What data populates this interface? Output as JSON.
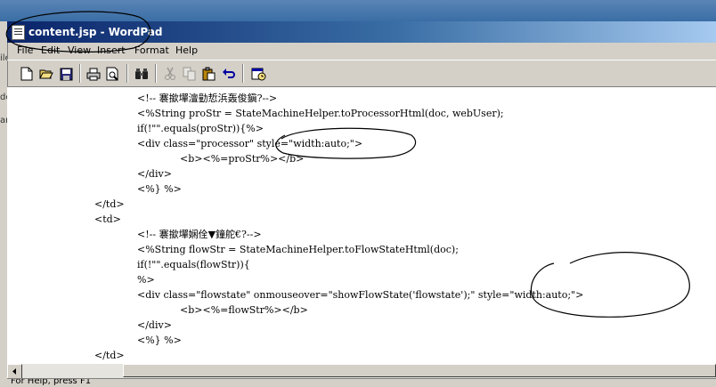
{
  "window": {
    "title": "content.jsp - WordPad"
  },
  "left_pane": {
    "fragments": [
      "ile",
      "dc",
      "ar"
    ]
  },
  "menu": [
    "File",
    "Edit",
    "View",
    "Insert",
    "Format",
    "Help"
  ],
  "toolbar": {
    "buttons": [
      {
        "name": "new-icon"
      },
      {
        "name": "open-icon"
      },
      {
        "name": "save-icon"
      },
      {
        "name": "print-icon"
      },
      {
        "name": "print-preview-icon"
      },
      {
        "name": "find-icon"
      },
      {
        "name": "cut-icon"
      },
      {
        "name": "copy-icon"
      },
      {
        "name": "paste-icon"
      },
      {
        "name": "undo-icon"
      },
      {
        "name": "insert-date-time-icon"
      }
    ]
  },
  "document": {
    "lines": [
      "<!-- 褰撳墠澶勭悊浜轰俊鎭?-->",
      "<%String proStr = StateMachineHelper.toProcessorHtml(doc, webUser);",
      "if(!\"\".equals(proStr)){%>",
      "<div class=\"processor\" style=\"width:auto;\">",
      "<b><%=proStr%></b>",
      "</div>",
      "<%} %>",
      "</td>",
      "<td>",
      "<!-- 褰撳墠娴佺▼鐘舵€?-->",
      "<%String flowStr = StateMachineHelper.toFlowStateHtml(doc);",
      "if(!\"\".equals(flowStr)){",
      "%>",
      "<div class=\"flowstate\" onmouseover=\"showFlowState('flowstate');\" style=\"width:auto;\">",
      "<b><%=flowStr%></b>",
      "</div>",
      "<%} %>",
      "</td>"
    ]
  },
  "statusbar": {
    "text": "For Help, press F1"
  }
}
